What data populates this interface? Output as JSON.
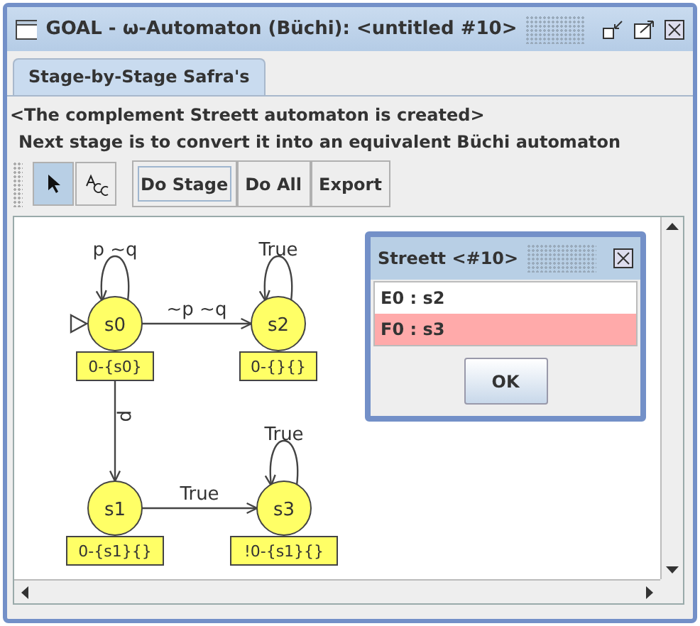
{
  "window": {
    "title": "GOAL - ω-Automaton (Büchi): <untitled #10>"
  },
  "tabs": [
    {
      "label": "Stage-by-Stage Safra's",
      "selected": true
    }
  ],
  "messages": [
    "<The complement Streett automaton is created>",
    "Next stage is to convert it into an equivalent Büchi automaton"
  ],
  "tools": [
    {
      "kind": "pointer",
      "selected": true
    },
    {
      "kind": "text",
      "selected": false
    }
  ],
  "buttons": [
    {
      "label": "Do Stage",
      "focused": true
    },
    {
      "label": "Do All",
      "focused": false
    },
    {
      "label": "Export",
      "focused": false
    }
  ],
  "graph": {
    "states": [
      {
        "name": "s0",
        "tag": "0-{s0}",
        "initial": true
      },
      {
        "name": "s2",
        "tag": "0-{}{}",
        "initial": false
      },
      {
        "name": "s1",
        "tag": "0-{s1}{}",
        "initial": false
      },
      {
        "name": "s3",
        "tag": "!0-{s1}{}",
        "initial": false
      }
    ],
    "transitions": [
      {
        "label": "p ~q"
      },
      {
        "label": "~p ~q"
      },
      {
        "label": "True"
      },
      {
        "label": "p"
      },
      {
        "label": "True"
      },
      {
        "label": "True"
      }
    ]
  },
  "dialog": {
    "title": "Streett <#10>",
    "items": [
      {
        "label": "E0 : s2",
        "selected": false
      },
      {
        "label": "F0 : s3",
        "selected": true
      }
    ],
    "button": "OK"
  }
}
